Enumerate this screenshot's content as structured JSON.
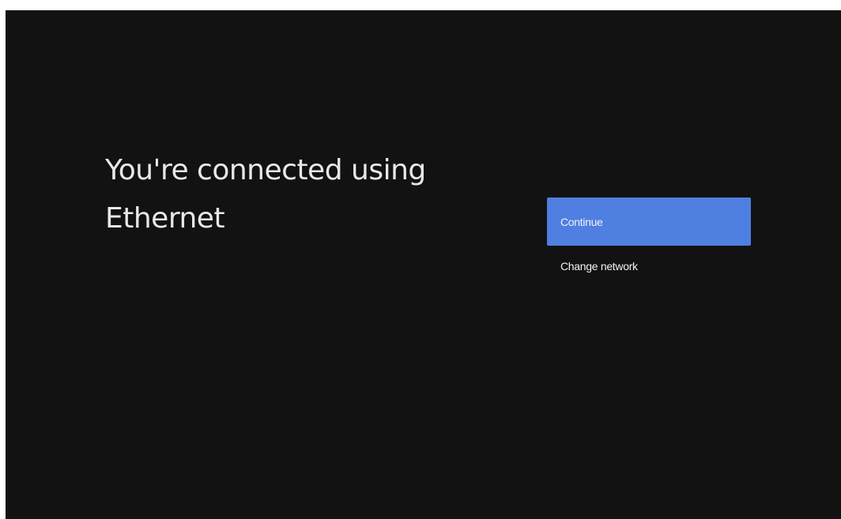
{
  "screen": {
    "title_line1": "You're connected using",
    "title_line2": "Ethernet"
  },
  "actions": {
    "continue_label": "Continue",
    "change_network_label": "Change network"
  },
  "colors": {
    "background": "#121212",
    "accent": "#4f7fe0"
  }
}
